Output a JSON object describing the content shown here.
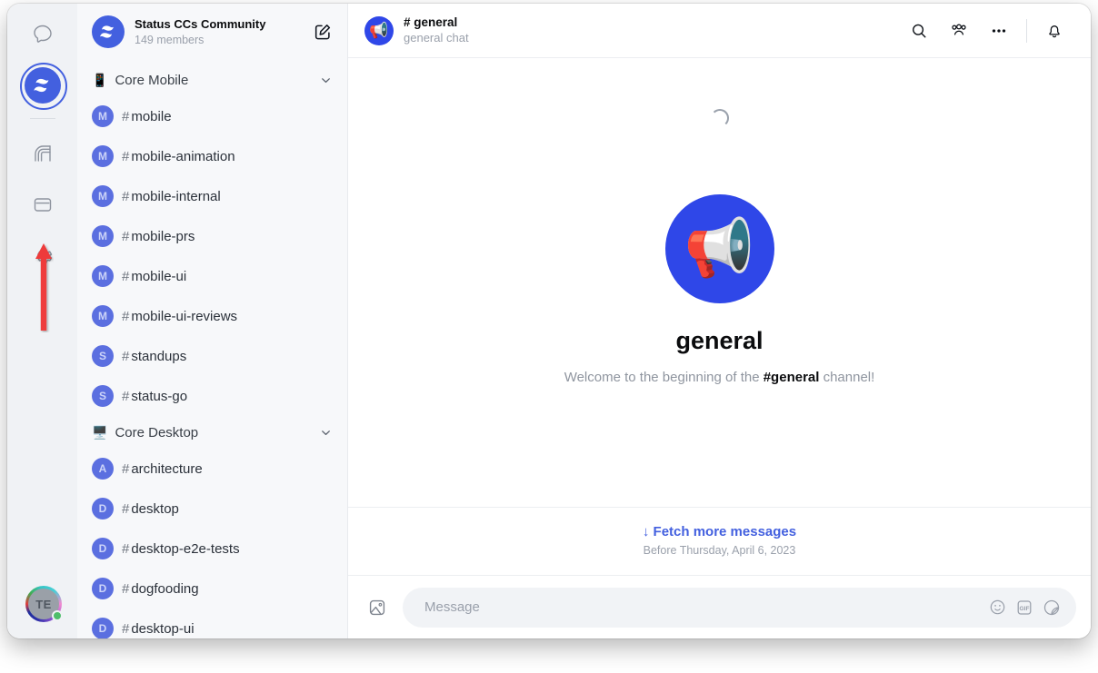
{
  "rail": {
    "items": [
      {
        "name": "messages",
        "icon": "chat-bubble-icon"
      },
      {
        "name": "community",
        "icon": "status-logo-icon",
        "selected": true
      },
      {
        "name": "wallet",
        "icon": "wallet-arc-icon"
      },
      {
        "name": "browser",
        "icon": "browser-card-icon"
      },
      {
        "name": "settings",
        "icon": "gear-icon"
      }
    ],
    "annotation": {
      "type": "arrow",
      "color": "#ee3b3b",
      "points_to": "settings"
    },
    "user": {
      "initials": "TE",
      "presence": "online"
    }
  },
  "sidebar": {
    "community_name": "Status CCs Community",
    "members": "149 members",
    "compose_label": "compose-icon",
    "categories": [
      {
        "emoji": "📱",
        "label": "Core Mobile",
        "expanded": true,
        "channels": [
          {
            "initial": "M",
            "hash": "#",
            "name": "mobile"
          },
          {
            "initial": "M",
            "hash": "#",
            "name": "mobile-animation"
          },
          {
            "initial": "M",
            "hash": "#",
            "name": "mobile-internal"
          },
          {
            "initial": "M",
            "hash": "#",
            "name": "mobile-prs"
          },
          {
            "initial": "M",
            "hash": "#",
            "name": "mobile-ui"
          },
          {
            "initial": "M",
            "hash": "#",
            "name": "mobile-ui-reviews"
          },
          {
            "initial": "S",
            "hash": "#",
            "name": "standups"
          },
          {
            "initial": "S",
            "hash": "#",
            "name": "status-go"
          }
        ]
      },
      {
        "emoji": "🖥️",
        "label": "Core Desktop",
        "expanded": true,
        "channels": [
          {
            "initial": "A",
            "hash": "#",
            "name": "architecture"
          },
          {
            "initial": "D",
            "hash": "#",
            "name": "desktop"
          },
          {
            "initial": "D",
            "hash": "#",
            "name": "desktop-e2e-tests"
          },
          {
            "initial": "D",
            "hash": "#",
            "name": "dogfooding"
          },
          {
            "initial": "D",
            "hash": "#",
            "name": "desktop-ui"
          }
        ]
      }
    ]
  },
  "chat": {
    "emoji": "📢",
    "title": "# general",
    "subtitle": "general chat",
    "actions": [
      {
        "name": "search",
        "icon": "search-icon"
      },
      {
        "name": "members",
        "icon": "members-icon"
      },
      {
        "name": "more",
        "icon": "more-horizontal-icon"
      },
      {
        "name": "notifications",
        "icon": "bell-icon"
      }
    ],
    "loading": true,
    "empty_state": {
      "emoji": "📢",
      "title": "general",
      "welcome_prefix": "Welcome to the beginning of the ",
      "welcome_channel": "#general",
      "welcome_suffix": " channel!"
    },
    "fetch": {
      "label": "↓ Fetch more messages",
      "date": "Before Thursday, April 6, 2023"
    },
    "composer": {
      "placeholder": "Message",
      "value": "",
      "icons": [
        "emoji-icon",
        "gif-icon",
        "sticker-icon"
      ],
      "gif_label": "GIF"
    }
  },
  "colors": {
    "accent": "#4360df",
    "accent_strong": "#2f47e8",
    "annotation": "#ee3b3b",
    "sidebar_bg": "#f7f8fa",
    "rail_bg": "#f0f2f5",
    "online": "#4ebe6a"
  }
}
